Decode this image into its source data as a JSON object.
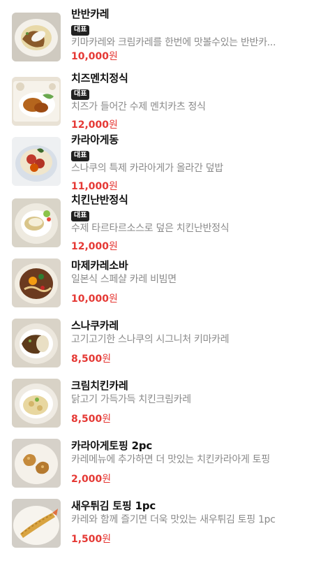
{
  "menu": {
    "items": [
      {
        "name": "반반카레",
        "badge": "대표",
        "description": "키마카레와 크림카레를 한번에 맛볼수있는 반반카...",
        "price": "10,000",
        "currency": "원",
        "image": "half-half-curry-icon",
        "colors": {
          "plate": "#f4f1ea",
          "food": "#8a5a2a",
          "accent": "#e8d9a8"
        }
      },
      {
        "name": "치즈멘치정식",
        "badge": "대표",
        "description": "치즈가 들어간 수제 멘치카츠 정식",
        "price": "12,000",
        "currency": "원",
        "image": "cheese-menchi-set-icon",
        "colors": {
          "plate": "#e9e2d5",
          "food": "#b5651d",
          "accent": "#6aa84f"
        }
      },
      {
        "name": "카라아게동",
        "badge": "대표",
        "description": "스나쿠의 특제 카라아게가 올라간 덮밥",
        "price": "11,000",
        "currency": "원",
        "image": "karaage-don-icon",
        "colors": {
          "plate": "#d8dfe8",
          "food": "#c0392b",
          "accent": "#f0e6cc"
        }
      },
      {
        "name": "치킨난반정식",
        "badge": "대표",
        "description": "수제 타르타르소스로 덮은 치킨난반정식",
        "price": "12,000",
        "currency": "원",
        "image": "chicken-nanban-set-icon",
        "colors": {
          "plate": "#eeeae0",
          "food": "#d9c58a",
          "accent": "#8bc34a"
        }
      },
      {
        "name": "마제카레소바",
        "badge": "",
        "description": "일본식 스페샬 카레 비빔면",
        "price": "10,000",
        "currency": "원",
        "image": "maze-curry-soba-icon",
        "colors": {
          "plate": "#f2ede2",
          "food": "#6b3a1f",
          "accent": "#f39c12"
        }
      },
      {
        "name": "스나쿠카레",
        "badge": "",
        "description": "고기고기한 스나쿠의 시그니처 키마카레",
        "price": "8,500",
        "currency": "원",
        "image": "snaku-curry-icon",
        "colors": {
          "plate": "#ece7dd",
          "food": "#5d3a1a",
          "accent": "#e9dfc4"
        }
      },
      {
        "name": "크림치킨카레",
        "badge": "",
        "description": "닭고기 가득가득 치킨크림카레",
        "price": "8,500",
        "currency": "원",
        "image": "cream-chicken-curry-icon",
        "colors": {
          "plate": "#efebe3",
          "food": "#e8d7a0",
          "accent": "#7cb342"
        }
      },
      {
        "name": "카라아게토핑 2pc",
        "badge": "",
        "description": "카레메뉴에 추가하면 더 맛있는 치킨카라아게 토핑",
        "price": "2,000",
        "currency": "원",
        "image": "karaage-topping-icon",
        "colors": {
          "plate": "#e8e4de",
          "food": "#c58a3c",
          "accent": "#f5f1ea"
        }
      },
      {
        "name": "새우튀김 토핑 1pc",
        "badge": "",
        "description": "카레와 함께 즐기면 더욱 맛있는 새우튀김 토핑 1pc",
        "price": "1,500",
        "currency": "원",
        "image": "fried-shrimp-topping-icon",
        "colors": {
          "plate": "#e6e3de",
          "food": "#d9a441",
          "accent": "#f7f4ee"
        }
      }
    ]
  }
}
